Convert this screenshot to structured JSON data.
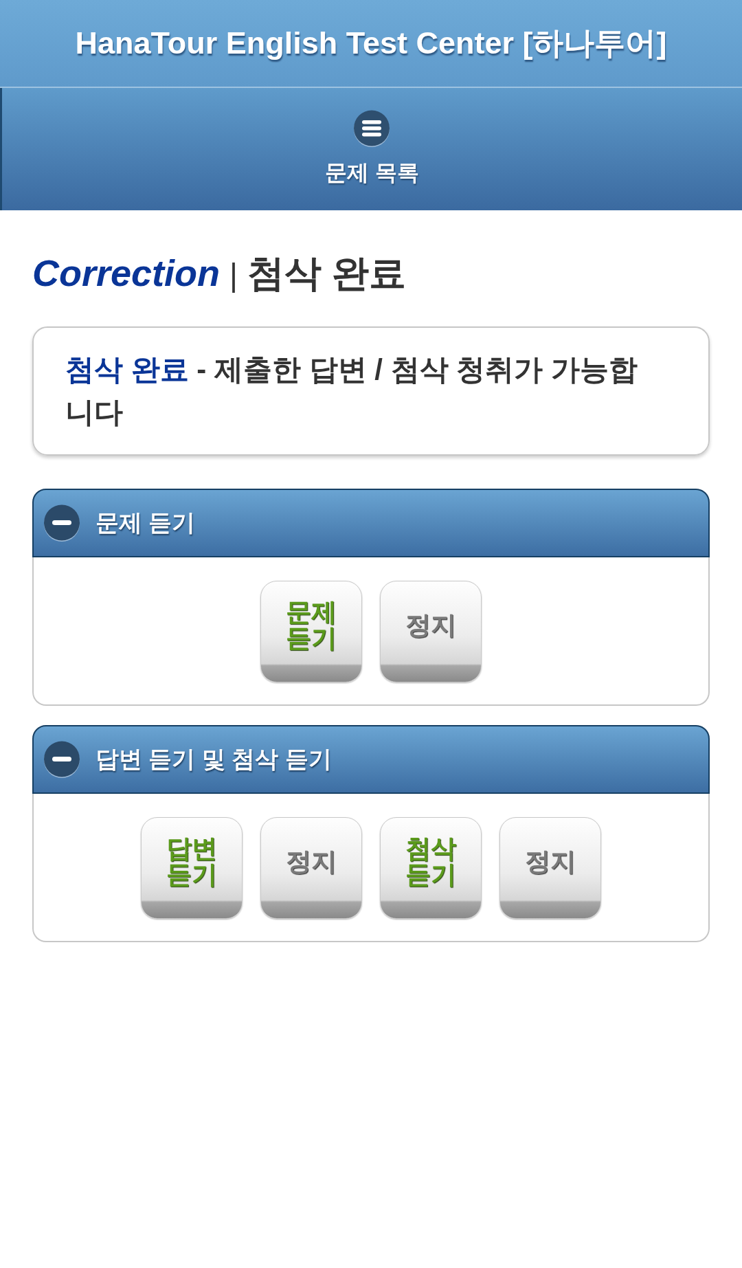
{
  "header": {
    "title": "HanaTour English Test Center [하나투어]"
  },
  "nav": {
    "label": "문제 목록"
  },
  "heading": {
    "title": "Correction",
    "separator": "|",
    "subtitle": "첨삭 완료"
  },
  "notice": {
    "highlight": "첨삭 완료",
    "text": "- 제출한 답변 / 첨삭 청취가 가능합니다"
  },
  "sections": [
    {
      "title": "문제 듣기",
      "expanded": true,
      "buttons": [
        {
          "label": "문제 듣기",
          "kind": "play"
        },
        {
          "label": "정지",
          "kind": "stop"
        }
      ]
    },
    {
      "title": "답변 듣기 및 첨삭 듣기",
      "expanded": true,
      "buttons": [
        {
          "label": "답변 듣기",
          "kind": "play"
        },
        {
          "label": "정지",
          "kind": "stop"
        },
        {
          "label": "첨삭 듣기",
          "kind": "play"
        },
        {
          "label": "정지",
          "kind": "stop"
        }
      ]
    }
  ]
}
